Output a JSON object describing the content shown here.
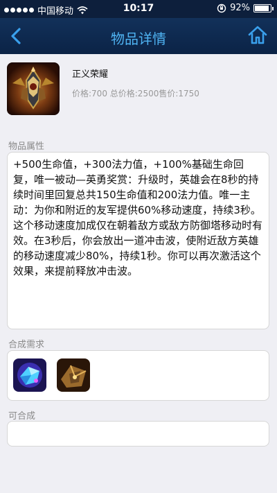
{
  "status": {
    "carrier": "中国移动",
    "time": "10:17",
    "battery_text": "92%",
    "battery_level": 0.92
  },
  "nav": {
    "title": "物品详情"
  },
  "item": {
    "name": "正义荣耀",
    "price_line": "价格:700 总价格:2500售价:1750"
  },
  "sections": {
    "attributes_label": "物品属性",
    "attributes_text": "+500生命值，+300法力值，+100%基础生命回复，唯一被动—英勇奖赏：升级时，英雄会在8秒的持续时间里回复总共150生命值和200法力值。唯一主动：为你和附近的友军提供60%移动速度，持续3秒。这个移动速度加成仅在朝着敌方或敌方防御塔移动时有效。在3秒后，你会放出一道冲击波，使附近敌方英雄的移动速度减少80%，持续1秒。你可以再次激活这个效果，来提前释放冲击波。",
    "requires_label": "合成需求",
    "builds_into_label": "可合成"
  }
}
